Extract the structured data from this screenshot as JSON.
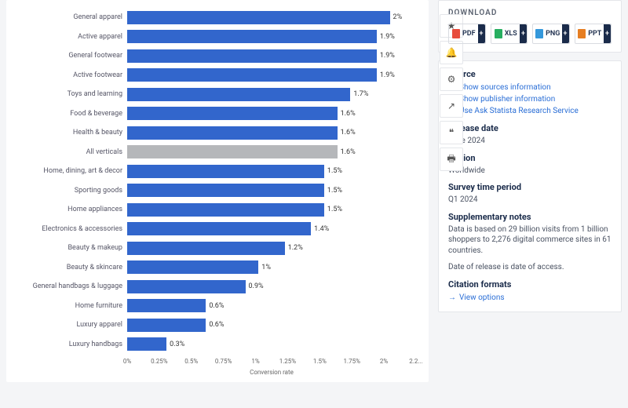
{
  "chart_data": {
    "type": "bar",
    "orientation": "horizontal",
    "xlabel": "Conversion rate",
    "ylabel": "",
    "xlim": [
      0,
      2.2
    ],
    "ticks": [
      "0%",
      "0.25%",
      "0.5%",
      "0.75%",
      "1%",
      "1.25%",
      "1.5%",
      "1.75%",
      "2%",
      "2.2..."
    ],
    "highlight_category": "All verticals",
    "series": [
      {
        "category": "General apparel",
        "value": 2.0,
        "label": "2%"
      },
      {
        "category": "Active apparel",
        "value": 1.9,
        "label": "1.9%"
      },
      {
        "category": "General footwear",
        "value": 1.9,
        "label": "1.9%"
      },
      {
        "category": "Active footwear",
        "value": 1.9,
        "label": "1.9%"
      },
      {
        "category": "Toys and learning",
        "value": 1.7,
        "label": "1.7%"
      },
      {
        "category": "Food & beverage",
        "value": 1.6,
        "label": "1.6%"
      },
      {
        "category": "Health & beauty",
        "value": 1.6,
        "label": "1.6%"
      },
      {
        "category": "All verticals",
        "value": 1.6,
        "label": "1.6%"
      },
      {
        "category": "Home, dining, art & decor",
        "value": 1.5,
        "label": "1.5%"
      },
      {
        "category": "Sporting goods",
        "value": 1.5,
        "label": "1.5%"
      },
      {
        "category": "Home appliances",
        "value": 1.5,
        "label": "1.5%"
      },
      {
        "category": "Electronics & accessories",
        "value": 1.4,
        "label": "1.4%"
      },
      {
        "category": "Beauty & makeup",
        "value": 1.2,
        "label": "1.2%"
      },
      {
        "category": "Beauty & skincare",
        "value": 1.0,
        "label": "1%"
      },
      {
        "category": "General handbags & luggage",
        "value": 0.9,
        "label": "0.9%"
      },
      {
        "category": "Home furniture",
        "value": 0.6,
        "label": "0.6%"
      },
      {
        "category": "Luxury apparel",
        "value": 0.6,
        "label": "0.6%"
      },
      {
        "category": "Luxury handbags",
        "value": 0.3,
        "label": "0.3%"
      }
    ]
  },
  "toolbar": {
    "star": "★",
    "bell": "🔔",
    "settings": "⚙",
    "share": "↗",
    "cite": "❝",
    "print": "🖶"
  },
  "download": {
    "title": "DOWNLOAD",
    "pdf": "PDF",
    "xls": "XLS",
    "png": "PNG",
    "ppt": "PPT"
  },
  "info": {
    "source_h": "Source",
    "source_links": [
      "Show sources information",
      "Show publisher information",
      "Use Ask Statista Research Service"
    ],
    "release_h": "Release date",
    "release_v": "June 2024",
    "region_h": "Region",
    "region_v": "Worldwide",
    "period_h": "Survey time period",
    "period_v": "Q1 2024",
    "supp_h": "Supplementary notes",
    "supp_v": "Data is based on 29 billion visits from 1 billion shoppers to 2,276 digital commerce sites in 61 countries.",
    "supp_v2": "Date of release is date of access.",
    "citation_h": "Citation formats",
    "citation_link": "View options"
  }
}
